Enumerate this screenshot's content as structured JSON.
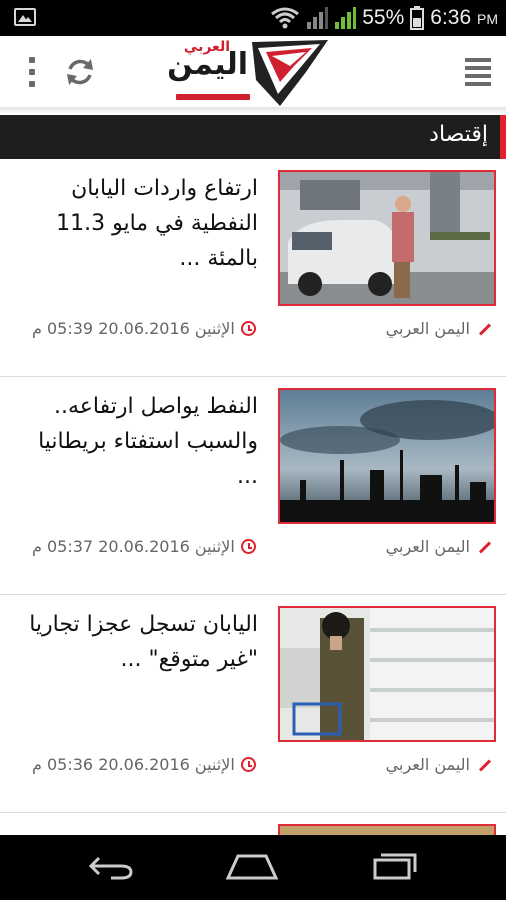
{
  "status_bar": {
    "battery_percent": "55%",
    "time": "6:36",
    "ampm": "PM",
    "icons": [
      "picture-icon",
      "wifi-icon",
      "signal-icon",
      "battery-icon"
    ]
  },
  "header": {
    "logo_title": "اليمن",
    "logo_subtitle": "العربي",
    "icons": [
      "overflow-menu-icon",
      "refresh-icon",
      "hamburger-menu-icon"
    ],
    "accent_color": "#e0202d"
  },
  "section": {
    "title": "إقتصاد"
  },
  "articles": [
    {
      "title": "ارتفاع واردات اليابان النفطية في مايو 11.3 بالمئة ...",
      "source": "اليمن العربي",
      "datetime": "الإثنين 20.06.2016 05:39 م"
    },
    {
      "title": "النفط يواصل ارتفاعه.. والسبب استفتاء بريطانيا ...",
      "source": "اليمن العربي",
      "datetime": "الإثنين 20.06.2016 05:37 م"
    },
    {
      "title": "اليابان تسجل عجزا تجاريا \"غير متوقع\" ...",
      "source": "اليمن العربي",
      "datetime": "الإثنين 20.06.2016 05:36 م"
    }
  ],
  "nav_bar": {
    "icons": [
      "back-icon",
      "home-icon",
      "recent-apps-icon"
    ]
  }
}
